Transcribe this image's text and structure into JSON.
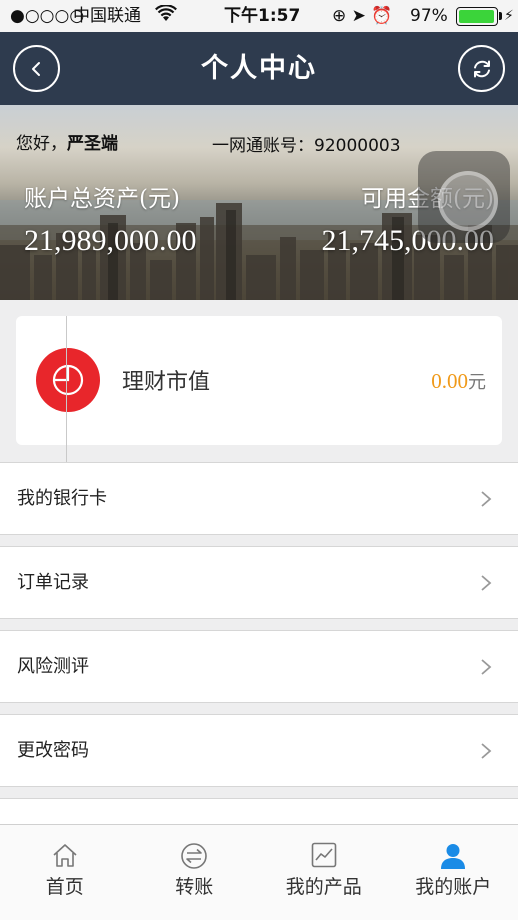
{
  "status_bar": {
    "signal": "●○○○○",
    "carrier": "中国联通",
    "wifi_icon": "wifi-icon",
    "time": "下午1:57",
    "icons": "⊕ ➤ ⏰",
    "battery_percent": "97%",
    "battery_level": 0.97
  },
  "nav": {
    "title": "个人中心",
    "back_icon": "chevron-left-icon",
    "refresh_icon": "refresh-icon"
  },
  "account": {
    "greeting_prefix": "您好，",
    "user_name": "严圣端",
    "account_label": "一网通账号：",
    "account_number": "92000003",
    "total_assets_label": "账户总资产(元)",
    "total_assets_value": "21,989,000.00",
    "available_label": "可用金额(元)",
    "available_value": "21,745,000.00"
  },
  "wealth": {
    "icon": "pie-chart-icon",
    "label": "理财市值",
    "value": "0.00",
    "unit": "元",
    "icon_color": "#e8262b",
    "value_color": "#f09a1a"
  },
  "menu": {
    "items": [
      {
        "label": "我的银行卡"
      },
      {
        "label": "订单记录"
      },
      {
        "label": "风险测评"
      },
      {
        "label": "更改密码"
      }
    ]
  },
  "tabs": [
    {
      "label": "首页",
      "icon": "home-icon",
      "active": false
    },
    {
      "label": "转账",
      "icon": "transfer-icon",
      "active": false
    },
    {
      "label": "我的产品",
      "icon": "chart-icon",
      "active": false
    },
    {
      "label": "我的账户",
      "icon": "user-icon",
      "active": true
    }
  ],
  "colors": {
    "nav_bg": "#2e3b4e",
    "active_tab": "#1a8be6"
  }
}
